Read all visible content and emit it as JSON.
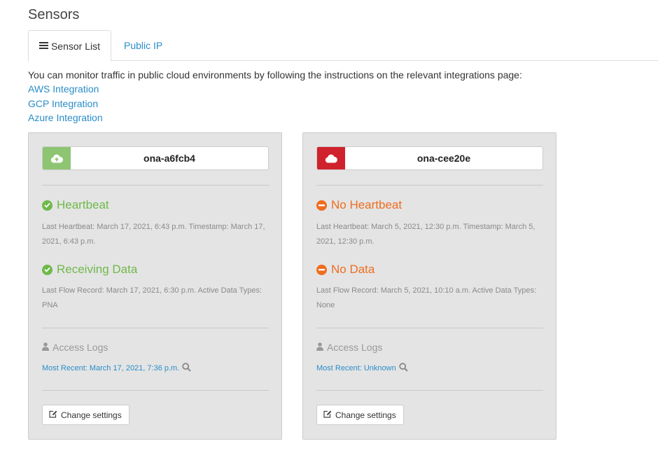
{
  "page": {
    "title": "Sensors"
  },
  "tabs": [
    {
      "label": "Sensor List",
      "icon": "list-icon",
      "active": true
    },
    {
      "label": "Public IP",
      "active": false
    }
  ],
  "intro": "You can monitor traffic in public cloud environments by following the instructions on the relevant integrations page:",
  "integration_links": [
    "AWS Integration",
    "GCP Integration",
    "Azure Integration"
  ],
  "colors": {
    "accent": "#2a8dc8",
    "ok": "#6fb94a",
    "warn": "#ee6d1f",
    "online": "#8dc572",
    "offline": "#d0222c"
  },
  "sensors": [
    {
      "name": "ona-a6fcb4",
      "cloud_icon": "cloud-upload-icon",
      "heartbeat": {
        "status": "Heartbeat",
        "state": "ok",
        "detail": "Last Heartbeat: March 17, 2021, 6:43 p.m. Timestamp: March 17, 2021, 6:43 p.m."
      },
      "data": {
        "status": "Receiving Data",
        "state": "ok",
        "detail": "Last Flow Record: March 17, 2021, 6:30 p.m. Active Data Types: PNA"
      },
      "access_logs": {
        "label": "Access Logs",
        "most_recent": "Most Recent: March 17, 2021, 7:36 p.m."
      },
      "settings_label": "Change settings"
    },
    {
      "name": "ona-cee20e",
      "cloud_icon": "cloud-icon",
      "heartbeat": {
        "status": "No Heartbeat",
        "state": "bad",
        "detail": "Last Heartbeat: March 5, 2021, 12:30 p.m. Timestamp: March 5, 2021, 12:30 p.m."
      },
      "data": {
        "status": "No Data",
        "state": "bad",
        "detail": "Last Flow Record: March 5, 2021, 10:10 a.m. Active Data Types: None"
      },
      "access_logs": {
        "label": "Access Logs",
        "most_recent": "Most Recent: Unknown"
      },
      "settings_label": "Change settings"
    }
  ]
}
